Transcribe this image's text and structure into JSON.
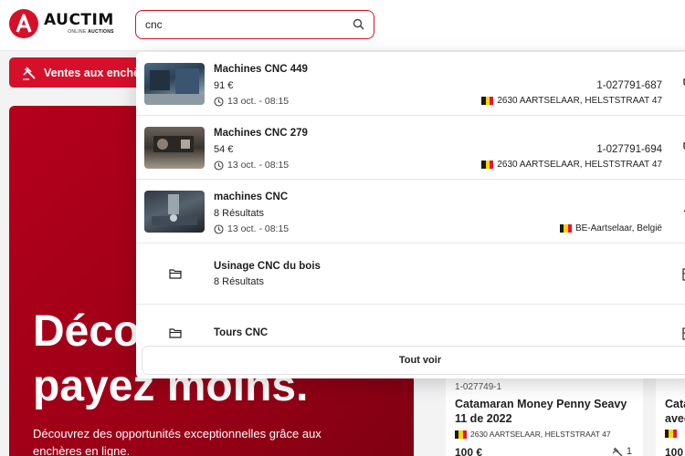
{
  "brand": {
    "name": "AUCTIM",
    "sub_light": "ONLINE",
    "sub_bold": "AUCTIONS"
  },
  "search": {
    "value": "cnc",
    "placeholder": ""
  },
  "nav": {
    "sales_button": "Ventes aux enchè"
  },
  "hero": {
    "title_line1": "Déco",
    "title_line2": "payez moins.",
    "description": "Découvrez des opportunités exceptionnelles grâce aux enchères en ligne."
  },
  "dropdown": {
    "results": [
      {
        "title": "Machines CNC 449",
        "sub": "91 €",
        "time": "13 oct. - 08:15",
        "ref": "1-027791-687",
        "location": "2630 AARTSELAAR, HELSTSTRAAT 47",
        "action_icon": "tag-icon"
      },
      {
        "title": "Machines CNC 279",
        "sub": "54 €",
        "time": "13 oct. - 08:15",
        "ref": "1-027791-694",
        "location": "2630 AARTSELAAR, HELSTSTRAAT 47",
        "action_icon": "tag-icon"
      },
      {
        "title": "machines CNC",
        "sub": "8 Résultats",
        "time": "13 oct. - 08:15",
        "ref": "",
        "location": "BE-Aartselaar, België",
        "action_icon": "gavel-icon"
      }
    ],
    "categories": [
      {
        "title": "Usinage CNC du bois",
        "sub": "8 Résultats"
      },
      {
        "title": "Tours CNC",
        "sub": ""
      }
    ],
    "see_all": "Tout voir"
  },
  "cards": [
    {
      "ref": "1-027749-1",
      "title": "Catamaran Money Penny Seavy 11 de 2022",
      "location": "2630 AARTSELAAR, HELSTSTRAAT 47",
      "price": "100 €",
      "bids": "1"
    },
    {
      "ref": "",
      "title": "Cata avec",
      "location": "",
      "price": "100",
      "bids": ""
    }
  ],
  "colors": {
    "accent": "#d6102a",
    "hero": "#a8001a"
  }
}
